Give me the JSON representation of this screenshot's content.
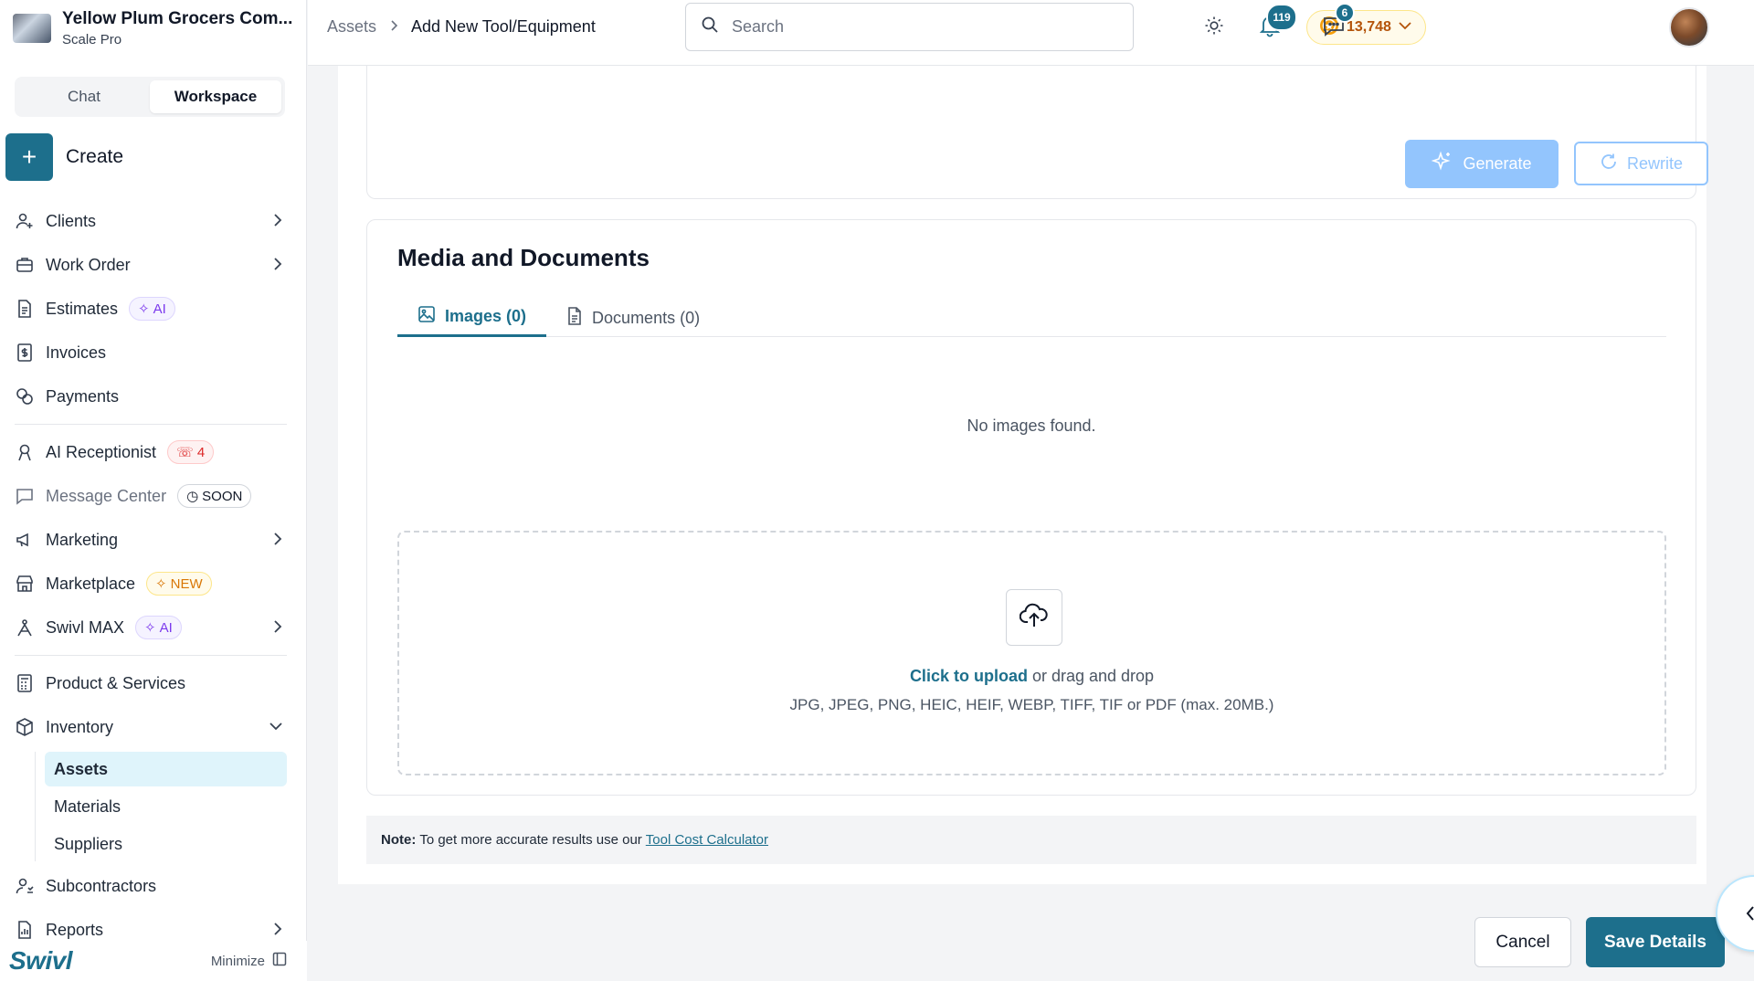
{
  "org": {
    "name": "Yellow Plum Grocers Com...",
    "plan": "Scale Pro"
  },
  "mode": {
    "chat": "Chat",
    "workspace": "Workspace"
  },
  "create_label": "Create",
  "nav": {
    "clients": "Clients",
    "work_order": "Work Order",
    "estimates": "Estimates",
    "estimates_badge": "AI",
    "invoices": "Invoices",
    "payments": "Payments",
    "ai_receptionist": "AI Receptionist",
    "ai_receptionist_badge": "4",
    "message_center": "Message Center",
    "message_center_badge": "SOON",
    "marketing": "Marketing",
    "marketplace": "Marketplace",
    "marketplace_badge": "NEW",
    "swivl_max": "Swivl MAX",
    "swivl_max_badge": "AI",
    "product_services": "Product & Services",
    "inventory": "Inventory",
    "inventory_sub": [
      "Assets",
      "Materials",
      "Suppliers"
    ],
    "subcontractors": "Subcontractors",
    "reports": "Reports"
  },
  "brand": "Swivl",
  "minimize_label": "Minimize",
  "breadcrumb": {
    "parent": "Assets",
    "current": "Add New Tool/Equipment"
  },
  "search": {
    "placeholder": "Search"
  },
  "coins": "13,748",
  "notifications_count": "119",
  "messages_count": "6",
  "description_card": {
    "generate": "Generate",
    "rewrite": "Rewrite"
  },
  "media": {
    "title": "Media and Documents",
    "tab_images": "Images (0)",
    "tab_documents": "Documents (0)",
    "empty": "No images found.",
    "upload_link": "Click to upload",
    "upload_rest": " or drag and drop",
    "upload_formats": "JPG, JPEG, PNG, HEIC, HEIF, WEBP, TIFF, TIF or PDF (max. 20MB.)"
  },
  "note": {
    "label": "Note:",
    "text": "To get more accurate results use our",
    "link": "Tool Cost Calculator"
  },
  "actions": {
    "cancel": "Cancel",
    "save": "Save Details"
  },
  "colors": {
    "primary": "#1d6f8c",
    "generate_disabled": "#93c5fd",
    "active_nav_bg": "#dff4fb"
  }
}
